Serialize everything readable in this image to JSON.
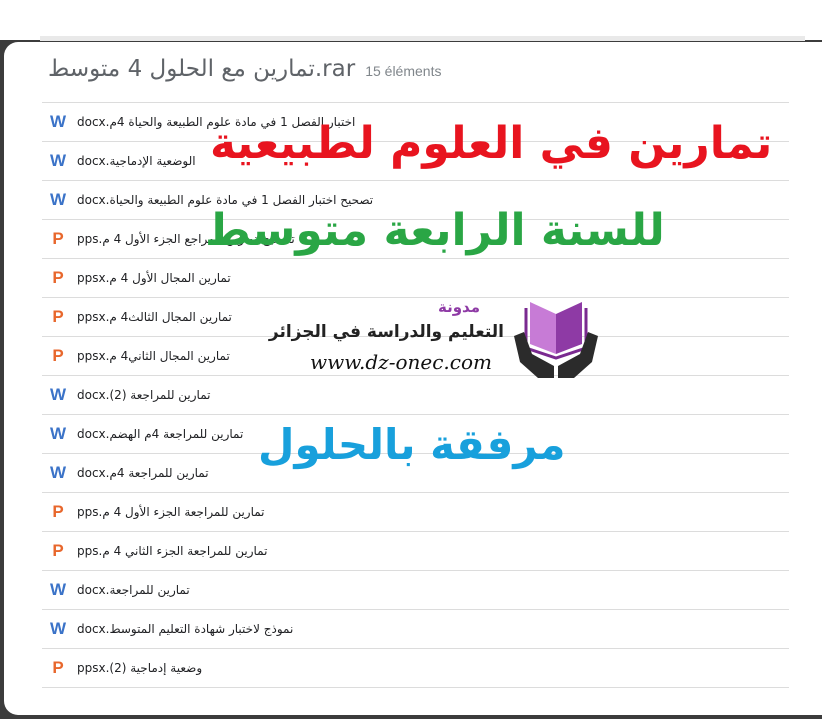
{
  "header": {
    "archive_name": "تمارين مع الحلول 4 متوسط.rar",
    "item_count": "15 éléments"
  },
  "files": [
    {
      "type": "word",
      "icon_glyph": "W",
      "name": "اختبار الفصل 1 في مادة علوم الطبيعة والحياة 4م.docx"
    },
    {
      "type": "word",
      "icon_glyph": "W",
      "name": "الوضعية الإدماجية.docx"
    },
    {
      "type": "word",
      "icon_glyph": "W",
      "name": "تصحيح اختبار الفصل 1 في مادة علوم الطبيعة والحياة.docx"
    },
    {
      "type": "powerpoint",
      "icon_glyph": "P",
      "name": "تصحيح تمارين المراجع الجزء الأول 4 م.pps"
    },
    {
      "type": "powerpoint",
      "icon_glyph": "P",
      "name": "تمارين المجال الأول 4 م.ppsx"
    },
    {
      "type": "powerpoint",
      "icon_glyph": "P",
      "name": "تمارين المجال الثالث4 م.ppsx"
    },
    {
      "type": "powerpoint",
      "icon_glyph": "P",
      "name": "تمارين المجال الثاني4 م.ppsx"
    },
    {
      "type": "word",
      "icon_glyph": "W",
      "name": "تمارين للمراجعة (2).docx"
    },
    {
      "type": "word",
      "icon_glyph": "W",
      "name": "تمارين للمراجعة 4م الهضم.docx"
    },
    {
      "type": "word",
      "icon_glyph": "W",
      "name": "تمارين للمراجعة 4م.docx"
    },
    {
      "type": "powerpoint",
      "icon_glyph": "P",
      "name": "تمارين للمراجعة الجزء الأول 4 م.pps"
    },
    {
      "type": "powerpoint",
      "icon_glyph": "P",
      "name": "تمارين للمراجعة الجزء الثاني 4 م.pps"
    },
    {
      "type": "word",
      "icon_glyph": "W",
      "name": "تمارين للمراجعة.docx"
    },
    {
      "type": "word",
      "icon_glyph": "W",
      "name": "نموذج لاختبار شهادة التعليم المتوسط.docx"
    },
    {
      "type": "powerpoint",
      "icon_glyph": "P",
      "name": "وضعية إدماجية (2).ppsx"
    }
  ],
  "overlay": {
    "line1": "تمارين في العلوم لطبيعية",
    "line2": "للسنة الرابعة متوسط",
    "line3": "مرفقة بالحلول"
  },
  "logo": {
    "small": "مدونة",
    "main": "التعليم والدراسة في الجزائر",
    "url": "www.dz-onec.com",
    "icon": "open-book-in-hands-icon"
  },
  "colors": {
    "word_icon": "#3b73c8",
    "ppt_icon": "#e8672c",
    "overlay_red": "#e8141f",
    "overlay_green": "#2aa645",
    "overlay_blue": "#18a0dc",
    "logo_purple": "#8e3aa5"
  }
}
